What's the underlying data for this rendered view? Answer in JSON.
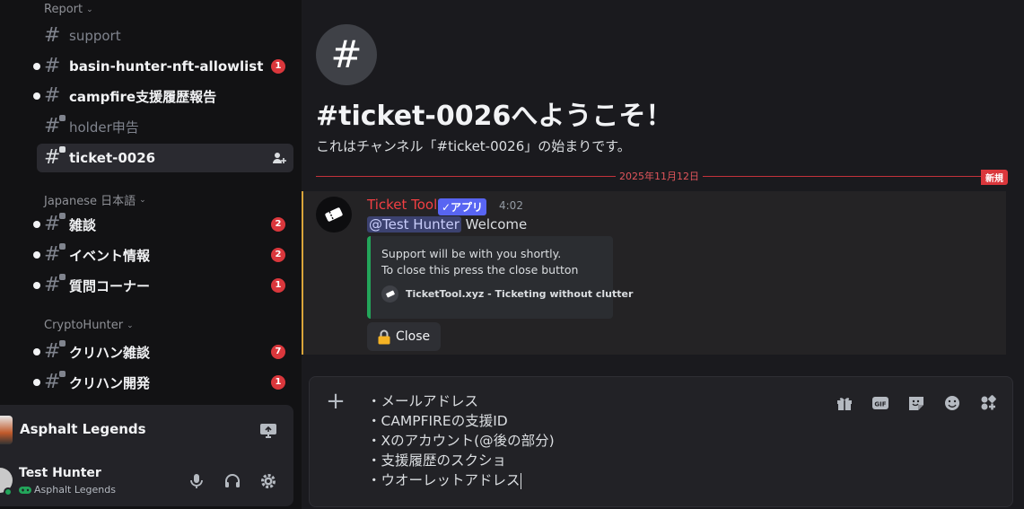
{
  "sidebar": {
    "categories": {
      "report": "Report",
      "japanese": "Japanese 日本語",
      "cryptohunter": "CryptoHunter"
    },
    "channels": [
      {
        "name": "support",
        "badge": null
      },
      {
        "name": "basin-hunter-nft-allowlist",
        "badge": "1"
      },
      {
        "name": "campfire支援履歴報告",
        "badge": null
      },
      {
        "name": "holder申告",
        "badge": null
      },
      {
        "name": "ticket-0026",
        "badge": null
      },
      {
        "name": "雑談",
        "badge": "2"
      },
      {
        "name": "イベント情報",
        "badge": "2"
      },
      {
        "name": "質問コーナー",
        "badge": "1"
      },
      {
        "name": "クリハン雑談",
        "badge": "7"
      },
      {
        "name": "クリハン開発",
        "badge": "1"
      }
    ]
  },
  "activity": {
    "game_title": "Asphalt Legends"
  },
  "user": {
    "name": "Test Hunter",
    "activity": "Asphalt Legends"
  },
  "channel": {
    "welcome_title": "#ticket-0026へようこそ！",
    "welcome_subtitle": "これはチャンネル「#ticket-0026」の始まりです。",
    "date_divider": "2025年11月12日",
    "new_tag": "新規"
  },
  "message": {
    "author": "Ticket Tool",
    "app_tag": "✓アプリ",
    "time": "4:02",
    "mention": "@Test Hunter",
    "text": " Welcome",
    "embed": {
      "line1": "Support will be with you shortly.",
      "line2": "To close this press the close button",
      "footer": "TicketTool.xyz - Ticketing without clutter"
    },
    "button_label": "Close"
  },
  "composer": {
    "lines": [
      "・メールアドレス",
      "・CAMPFIREの支援ID",
      "・Xのアカウント(@後の部分)",
      "・支援履歴のスクショ",
      "・ウオーレットアドレス"
    ]
  },
  "colors": {
    "accent": "#5865f2",
    "badge_red": "#da373c",
    "author_red": "#f23f43",
    "online_green": "#23a55a",
    "embed_border": "#23a55a",
    "highlight_border": "#d9a53a"
  }
}
